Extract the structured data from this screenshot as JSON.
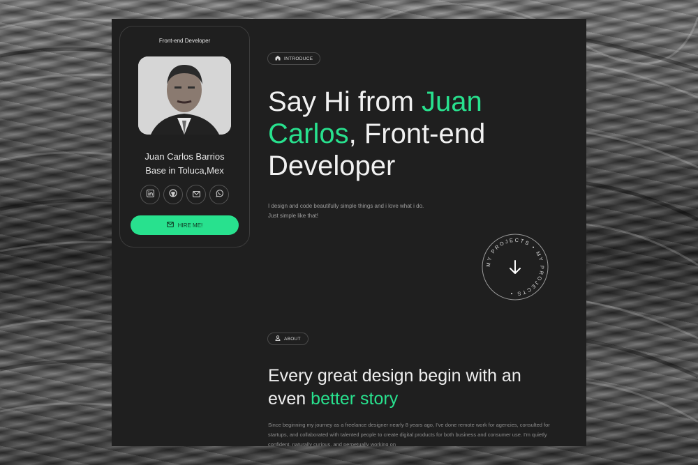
{
  "card": {
    "role": "Front-end Developer",
    "name_line1": "Juan Carlos Barrios",
    "name_line2": "Base in Toluca,Mex",
    "socials": [
      "linkedin-icon",
      "github-icon",
      "mail-icon",
      "whatsapp-icon"
    ],
    "hire_label": "HIRE ME!"
  },
  "intro": {
    "pill_label": "INTRODUCE",
    "hero_part1": "Say Hi from ",
    "hero_accent": "Juan Carlos",
    "hero_part2": ", Front-end Developer",
    "line1": "I design and code beautifully simple things and i love what i do.",
    "line2": "Just simple like that!",
    "badge_text": "MY PROJECTS • MY PROJECTS •"
  },
  "about": {
    "pill_label": "ABOUT",
    "heading_part1": "Every great design begin with an even ",
    "heading_accent": "better story",
    "text": "Since beginning my journey as a freelance designer nearly 8 years ago, I've done remote work for agencies, consulted for startups, and collaborated with talented people to create digital products for both business and consumer use. I'm quietly confident, naturally curious, and perpetually working on"
  },
  "colors": {
    "accent": "#28e18e",
    "panel": "#1f1f1f"
  }
}
